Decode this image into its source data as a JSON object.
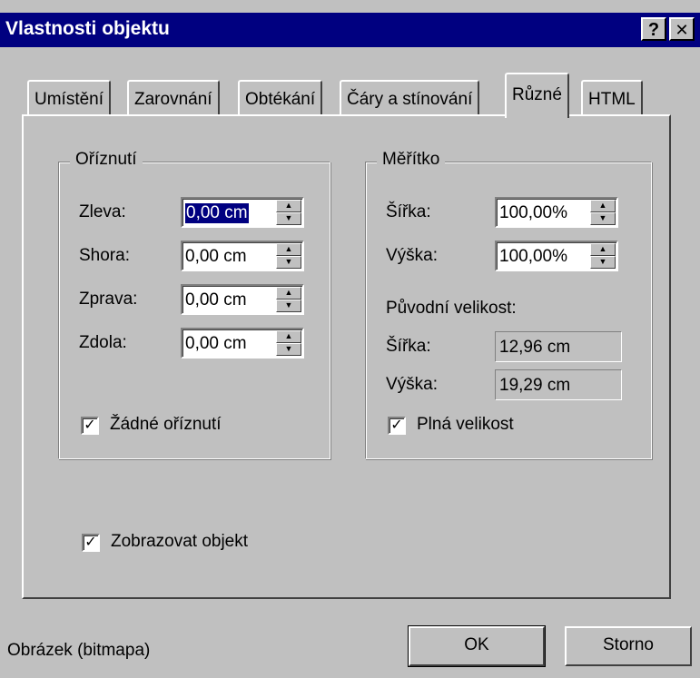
{
  "window": {
    "title": "Vlastnosti objektu",
    "help_glyph": "?",
    "close_glyph": "✕"
  },
  "tabs": [
    {
      "label": "Umístění"
    },
    {
      "label": "Zarovnání"
    },
    {
      "label": "Obtékání"
    },
    {
      "label": "Čáry a stínování"
    },
    {
      "label": "Různé",
      "active": true
    },
    {
      "label": "HTML"
    }
  ],
  "crop": {
    "legend": "Oříznutí",
    "rows": [
      {
        "label": "Zleva:",
        "value": "0,00 cm"
      },
      {
        "label": "Shora:",
        "value": "0,00 cm"
      },
      {
        "label": "Zprava:",
        "value": "0,00 cm"
      },
      {
        "label": "Zdola:",
        "value": "0,00 cm"
      }
    ],
    "no_crop_label": "Žádné oříznutí",
    "no_crop_checked": true
  },
  "scale": {
    "legend": "Měřítko",
    "rows": [
      {
        "label": "Šířka:",
        "value": "100,00%"
      },
      {
        "label": "Výška:",
        "value": "100,00%"
      }
    ],
    "original_label": "Původní velikost:",
    "original": [
      {
        "label": "Šířka:",
        "value": "12,96 cm"
      },
      {
        "label": "Výška:",
        "value": "19,29 cm"
      }
    ],
    "full_size_label": "Plná velikost",
    "full_size_checked": true
  },
  "show_object_label": "Zobrazovat objekt",
  "show_object_checked": true,
  "footer": {
    "object_type": "Obrázek (bitmapa)",
    "ok_label": "OK",
    "cancel_label": "Storno"
  },
  "spin_up_glyph": "▲",
  "spin_down_glyph": "▼",
  "check_glyph": "✓"
}
